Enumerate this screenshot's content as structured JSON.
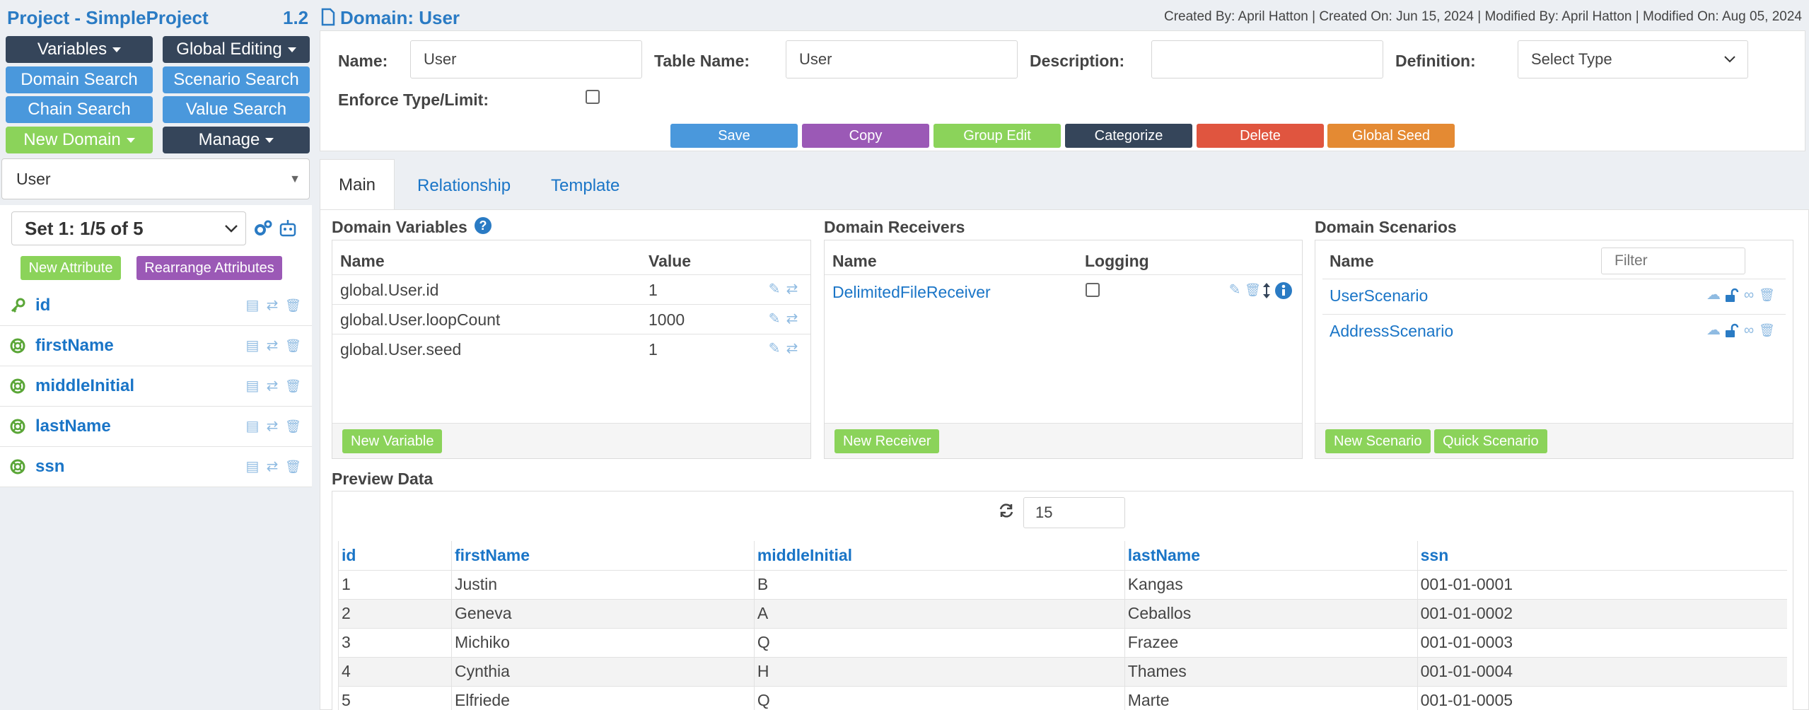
{
  "project": {
    "title": "Project - SimpleProject",
    "version": "1.2"
  },
  "sidebar": {
    "buttons": {
      "variables": "Variables",
      "global_editing": "Global Editing",
      "domain_search": "Domain Search",
      "scenario_search": "Scenario Search",
      "chain_search": "Chain Search",
      "value_search": "Value Search",
      "new_domain": "New Domain",
      "manage": "Manage"
    },
    "domain_select": "User",
    "set_select": "Set 1: 1/5 of 5",
    "new_attribute": "New Attribute",
    "rearrange_attributes": "Rearrange Attributes",
    "attributes": [
      {
        "name": "id",
        "icon": "key-icon"
      },
      {
        "name": "firstName",
        "icon": "lifebuoy-icon"
      },
      {
        "name": "middleInitial",
        "icon": "lifebuoy-icon"
      },
      {
        "name": "lastName",
        "icon": "lifebuoy-icon"
      },
      {
        "name": "ssn",
        "icon": "lifebuoy-icon"
      }
    ]
  },
  "header": {
    "domain_title": "Domain: User",
    "meta": "Created By: April Hatton | Created On: Jun 15, 2024 | Modified By: April Hatton | Modified On: Aug 05, 2024"
  },
  "form": {
    "name_label": "Name:",
    "name_value": "User",
    "table_name_label": "Table Name:",
    "table_name_value": "User",
    "description_label": "Description:",
    "description_value": "",
    "definition_label": "Definition:",
    "definition_value": "Select Type",
    "enforce_label": "Enforce Type/Limit:"
  },
  "actions": {
    "save": "Save",
    "copy": "Copy",
    "group_edit": "Group Edit",
    "categorize": "Categorize",
    "delete": "Delete",
    "global_seed": "Global Seed"
  },
  "tabs": [
    "Main",
    "Relationship",
    "Template"
  ],
  "variables_panel": {
    "title": "Domain Variables",
    "col_name": "Name",
    "col_value": "Value",
    "rows": [
      {
        "name": "global.User.id",
        "value": "1"
      },
      {
        "name": "global.User.loopCount",
        "value": "1000"
      },
      {
        "name": "global.User.seed",
        "value": "1"
      }
    ],
    "new_button": "New Variable"
  },
  "receivers_panel": {
    "title": "Domain Receivers",
    "col_name": "Name",
    "col_logging": "Logging",
    "rows": [
      {
        "name": "DelimitedFileReceiver"
      }
    ],
    "new_button": "New Receiver"
  },
  "scenarios_panel": {
    "title": "Domain Scenarios",
    "col_name": "Name",
    "filter_placeholder": "Filter",
    "rows": [
      {
        "name": "UserScenario"
      },
      {
        "name": "AddressScenario"
      }
    ],
    "new_button": "New Scenario",
    "quick_button": "Quick Scenario"
  },
  "preview": {
    "title": "Preview Data",
    "count": "15",
    "columns": [
      "id",
      "firstName",
      "middleInitial",
      "lastName",
      "ssn"
    ],
    "rows": [
      [
        "1",
        "Justin",
        "B",
        "Kangas",
        "001-01-0001"
      ],
      [
        "2",
        "Geneva",
        "A",
        "Ceballos",
        "001-01-0002"
      ],
      [
        "3",
        "Michiko",
        "Q",
        "Frazee",
        "001-01-0003"
      ],
      [
        "4",
        "Cynthia",
        "H",
        "Thames",
        "001-01-0004"
      ],
      [
        "5",
        "Elfriede",
        "Q",
        "Marte",
        "001-01-0005"
      ]
    ]
  }
}
